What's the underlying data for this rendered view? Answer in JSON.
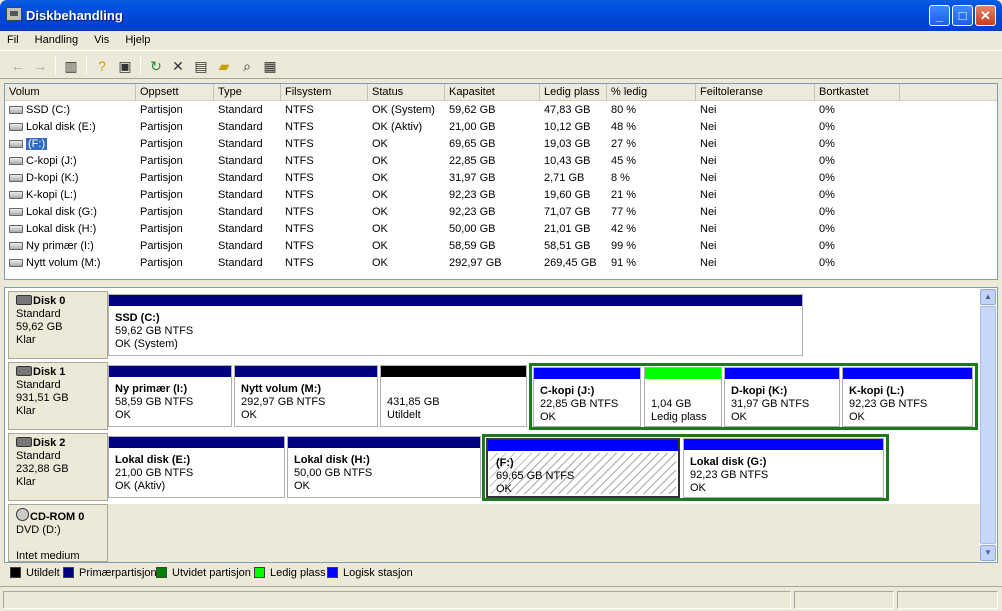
{
  "window": {
    "title": "Diskbehandling",
    "minimize": "_",
    "maximize": "□",
    "close": "✕"
  },
  "menu": [
    "Fil",
    "Handling",
    "Vis",
    "Hjelp"
  ],
  "toolbar": {
    "icons": [
      "back-icon",
      "forward-icon",
      "show-hide-console-tree-icon",
      "help-icon",
      "properties-view-icon",
      "refresh-icon",
      "delete-icon",
      "properties-icon",
      "open-icon",
      "explore-icon",
      "help-topics-icon"
    ]
  },
  "list": {
    "headers": [
      "Volum",
      "Oppsett",
      "Type",
      "Filsystem",
      "Status",
      "Kapasitet",
      "Ledig plass",
      "% ledig",
      "Feiltoleranse",
      "Bortkastet"
    ],
    "rows": [
      [
        "SSD (C:)",
        "Partisjon",
        "Standard",
        "NTFS",
        "OK (System)",
        "59,62 GB",
        "47,83 GB",
        "80 %",
        "Nei",
        "0%"
      ],
      [
        "Lokal disk (E:)",
        "Partisjon",
        "Standard",
        "NTFS",
        "OK (Aktiv)",
        "21,00 GB",
        "10,12 GB",
        "48 %",
        "Nei",
        "0%"
      ],
      [
        "(F:)",
        "Partisjon",
        "Standard",
        "NTFS",
        "OK",
        "69,65 GB",
        "19,03 GB",
        "27 %",
        "Nei",
        "0%"
      ],
      [
        "C-kopi (J:)",
        "Partisjon",
        "Standard",
        "NTFS",
        "OK",
        "22,85 GB",
        "10,43 GB",
        "45 %",
        "Nei",
        "0%"
      ],
      [
        "D-kopi (K:)",
        "Partisjon",
        "Standard",
        "NTFS",
        "OK",
        "31,97 GB",
        "2,71 GB",
        "8 %",
        "Nei",
        "0%"
      ],
      [
        "K-kopi (L:)",
        "Partisjon",
        "Standard",
        "NTFS",
        "OK",
        "92,23 GB",
        "19,60 GB",
        "21 %",
        "Nei",
        "0%"
      ],
      [
        "Lokal disk (G:)",
        "Partisjon",
        "Standard",
        "NTFS",
        "OK",
        "92,23 GB",
        "71,07 GB",
        "77 %",
        "Nei",
        "0%"
      ],
      [
        "Lokal disk (H:)",
        "Partisjon",
        "Standard",
        "NTFS",
        "OK",
        "50,00 GB",
        "21,01 GB",
        "42 %",
        "Nei",
        "0%"
      ],
      [
        "Ny primær (I:)",
        "Partisjon",
        "Standard",
        "NTFS",
        "OK",
        "58,59 GB",
        "58,51 GB",
        "99 %",
        "Nei",
        "0%"
      ],
      [
        "Nytt volum (M:)",
        "Partisjon",
        "Standard",
        "NTFS",
        "OK",
        "292,97 GB",
        "269,45 GB",
        "91 %",
        "Nei",
        "0%"
      ]
    ]
  },
  "disks": [
    {
      "name": "Disk 0",
      "type": "Standard",
      "size": "59,62 GB",
      "status": "Klar"
    },
    {
      "name": "Disk 1",
      "type": "Standard",
      "size": "931,51 GB",
      "status": "Klar"
    },
    {
      "name": "Disk 2",
      "type": "Standard",
      "size": "232,88 GB",
      "status": "Klar"
    },
    {
      "name": "CD-ROM 0",
      "type": "DVD (D:)",
      "size": "",
      "status": "Intet medium"
    }
  ],
  "partitions": {
    "d0p0": {
      "name": "SSD  (C:)",
      "size": "59,62 GB NTFS",
      "status": "OK (System)"
    },
    "d1p0": {
      "name": "Ny primær  (I:)",
      "size": "58,59 GB NTFS",
      "status": "OK"
    },
    "d1p1": {
      "name": "Nytt volum  (M:)",
      "size": "292,97 GB NTFS",
      "status": "OK"
    },
    "d1p2": {
      "name": "",
      "size": "431,85 GB",
      "status": "Utildelt"
    },
    "d1p3": {
      "name": "C-kopi  (J:)",
      "size": "22,85 GB NTFS",
      "status": "OK"
    },
    "d1p4": {
      "name": "",
      "size": "1,04 GB",
      "status": "Ledig plass"
    },
    "d1p5": {
      "name": "D-kopi  (K:)",
      "size": "31,97 GB NTFS",
      "status": "OK"
    },
    "d1p6": {
      "name": "K-kopi  (L:)",
      "size": "92,23 GB NTFS",
      "status": "OK"
    },
    "d2p0": {
      "name": "Lokal disk  (E:)",
      "size": "21,00 GB NTFS",
      "status": "OK (Aktiv)"
    },
    "d2p1": {
      "name": "Lokal disk  (H:)",
      "size": "50,00 GB NTFS",
      "status": "OK"
    },
    "d2p2": {
      "name": "(F:)",
      "size": "69,65 GB NTFS",
      "status": "OK"
    },
    "d2p3": {
      "name": "Lokal disk  (G:)",
      "size": "92,23 GB NTFS",
      "status": "OK"
    }
  },
  "legend": [
    {
      "label": "Utildelt",
      "color": "#000000"
    },
    {
      "label": "Primærpartisjon",
      "color": "#000080"
    },
    {
      "label": "Utvidet partisjon",
      "color": "#008000"
    },
    {
      "label": "Ledig plass",
      "color": "#00ff00"
    },
    {
      "label": "Logisk stasjon",
      "color": "#0000ff"
    }
  ],
  "colors": {
    "primary": "#000080",
    "logical": "#0000ff",
    "unallocated": "#000000",
    "free": "#00ff00",
    "extended": "#1b7a1b",
    "selection": "#316ac5"
  }
}
